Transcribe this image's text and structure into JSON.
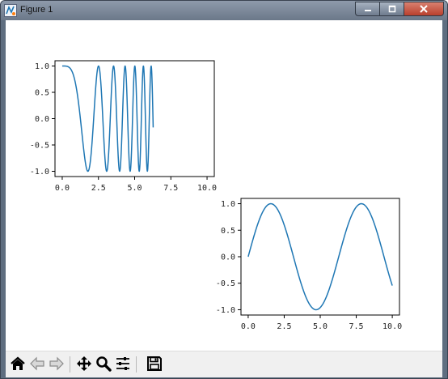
{
  "window": {
    "title": "Figure 1",
    "icons": {
      "app": "matplotlib-icon",
      "minimize": "minimize-icon",
      "maximize": "maximize-icon",
      "close": "close-icon"
    }
  },
  "toolbar": {
    "buttons": [
      {
        "name": "home-button",
        "icon": "home-icon"
      },
      {
        "name": "back-button",
        "icon": "arrow-left-icon"
      },
      {
        "name": "forward-button",
        "icon": "arrow-right-icon"
      },
      {
        "name": "pan-button",
        "icon": "move-icon"
      },
      {
        "name": "zoom-button",
        "icon": "magnifier-icon"
      },
      {
        "name": "configure-subplots-button",
        "icon": "sliders-icon"
      },
      {
        "name": "save-button",
        "icon": "floppy-disk-icon"
      }
    ]
  },
  "colors": {
    "line": "#1f77b4",
    "titlebar": "#7b8799",
    "toolbar": "#f0f0f0"
  },
  "chart_data": [
    {
      "type": "line",
      "xlim": [
        -0.5,
        10.5
      ],
      "ylim": [
        -1.1,
        1.1
      ],
      "xticks": [
        "0.0",
        "2.5",
        "5.0",
        "7.5",
        "10.0"
      ],
      "yticks": [
        "1.0",
        "0.5",
        "0.0",
        "-0.5",
        "-1.0"
      ],
      "series": [
        {
          "function": "cos(x^2)",
          "x_range": [
            0,
            6.28
          ],
          "samples": 600
        }
      ],
      "grid": false
    },
    {
      "type": "line",
      "xlim": [
        -0.5,
        10.5
      ],
      "ylim": [
        -1.1,
        1.1
      ],
      "xticks": [
        "0.0",
        "2.5",
        "5.0",
        "7.5",
        "10.0"
      ],
      "yticks": [
        "1.0",
        "0.5",
        "0.0",
        "-0.5",
        "-1.0"
      ],
      "series": [
        {
          "function": "sin(x)",
          "x_range": [
            0,
            10
          ],
          "samples": 200
        }
      ],
      "grid": false
    }
  ]
}
